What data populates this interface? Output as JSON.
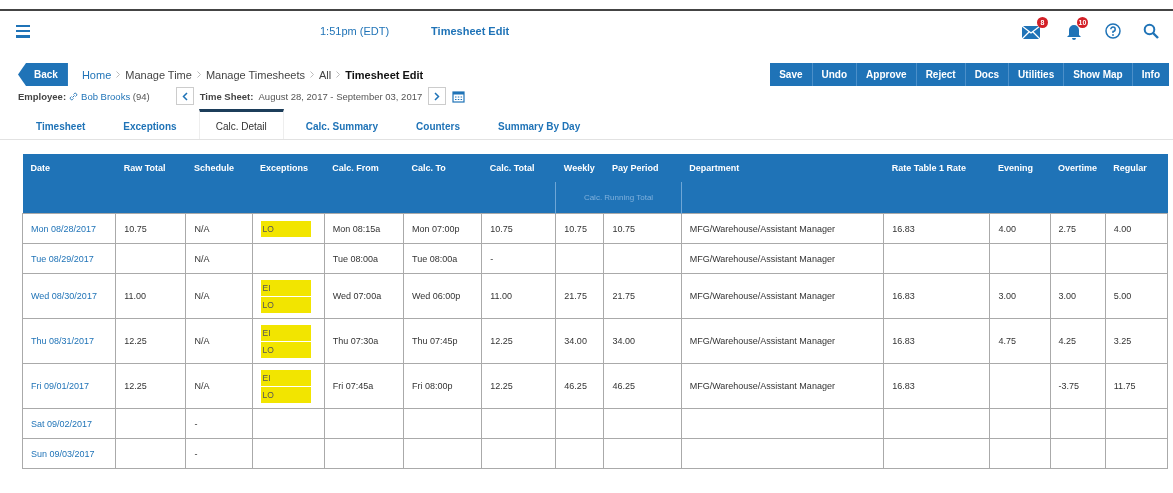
{
  "header": {
    "time": "1:51pm (EDT)",
    "title": "Timesheet Edit",
    "icons": [
      {
        "kind": "mail",
        "badge": "8"
      },
      {
        "kind": "bell",
        "badge": "10"
      },
      {
        "kind": "help"
      },
      {
        "kind": "search"
      }
    ]
  },
  "breadcrumb": {
    "back": "Back",
    "items": [
      {
        "label": "Home",
        "kind": "link"
      },
      {
        "label": "Manage Time",
        "kind": "text"
      },
      {
        "label": "Manage Timesheets",
        "kind": "text"
      },
      {
        "label": "All",
        "kind": "text"
      },
      {
        "label": "Timesheet Edit",
        "kind": "current"
      }
    ]
  },
  "toolbar": [
    "Save",
    "Undo",
    "Approve",
    "Reject",
    "Docs",
    "Utilities",
    "Show Map",
    "Info"
  ],
  "employee": {
    "label": "Employee:",
    "name": "Bob Brooks",
    "id": "(94)"
  },
  "timesheet": {
    "label": "Time Sheet:",
    "range": "August 28, 2017 - September 03, 2017"
  },
  "tabs": [
    {
      "label": "Timesheet",
      "selected": false
    },
    {
      "label": "Exceptions",
      "selected": false
    },
    {
      "label": "Calc. Detail",
      "selected": true
    },
    {
      "label": "Calc. Summary",
      "selected": false
    },
    {
      "label": "Counters",
      "selected": false
    },
    {
      "label": "Summary By Day",
      "selected": false
    }
  ],
  "table": {
    "columns": [
      "Date",
      "Raw Total",
      "Schedule",
      "Exceptions",
      "Calc. From",
      "Calc. To",
      "Calc. Total",
      "Weekly",
      "Pay Period",
      "Department",
      "Rate Table 1 Rate",
      "Evening",
      "Overtime",
      "Regular"
    ],
    "group_header": {
      "label": "Calc. Running Total"
    },
    "rows": [
      {
        "date": "Mon 08/28/2017",
        "raw_total": "10.75",
        "schedule": "N/A",
        "exceptions": [
          "LO"
        ],
        "calc_from": "Mon 08:15a",
        "calc_to": "Mon 07:00p",
        "calc_total": "10.75",
        "weekly": "10.75",
        "pay_period": "10.75",
        "department": "MFG/Warehouse/Assistant Manager",
        "rate": "16.83",
        "evening": "4.00",
        "overtime": "2.75",
        "regular": "4.00"
      },
      {
        "date": "Tue 08/29/2017",
        "schedule": "N/A",
        "calc_from": "Tue 08:00a",
        "calc_to": "Tue 08:00a",
        "calc_total": "-",
        "department": "MFG/Warehouse/Assistant Manager"
      },
      {
        "date": "Wed 08/30/2017",
        "raw_total": "11.00",
        "schedule": "N/A",
        "exceptions": [
          "EI",
          "LO"
        ],
        "calc_from": "Wed 07:00a",
        "calc_to": "Wed 06:00p",
        "calc_total": "11.00",
        "weekly": "21.75",
        "pay_period": "21.75",
        "department": "MFG/Warehouse/Assistant Manager",
        "rate": "16.83",
        "evening": "3.00",
        "overtime": "3.00",
        "regular": "5.00"
      },
      {
        "date": "Thu 08/31/2017",
        "raw_total": "12.25",
        "schedule": "N/A",
        "exceptions": [
          "EI",
          "LO"
        ],
        "calc_from": "Thu 07:30a",
        "calc_to": "Thu 07:45p",
        "calc_total": "12.25",
        "weekly": "34.00",
        "pay_period": "34.00",
        "department": "MFG/Warehouse/Assistant Manager",
        "rate": "16.83",
        "evening": "4.75",
        "overtime": "4.25",
        "regular": "3.25"
      },
      {
        "date": "Fri 09/01/2017",
        "raw_total": "12.25",
        "schedule": "N/A",
        "exceptions": [
          "EI",
          "LO"
        ],
        "calc_from": "Fri 07:45a",
        "calc_to": "Fri 08:00p",
        "calc_total": "12.25",
        "weekly": "46.25",
        "pay_period": "46.25",
        "department": "MFG/Warehouse/Assistant Manager",
        "rate": "16.83",
        "overtime": "-3.75",
        "regular": "11.75"
      },
      {
        "date": "Sat 09/02/2017",
        "schedule": "-"
      },
      {
        "date": "Sun 09/03/2017",
        "schedule": "-"
      }
    ]
  }
}
